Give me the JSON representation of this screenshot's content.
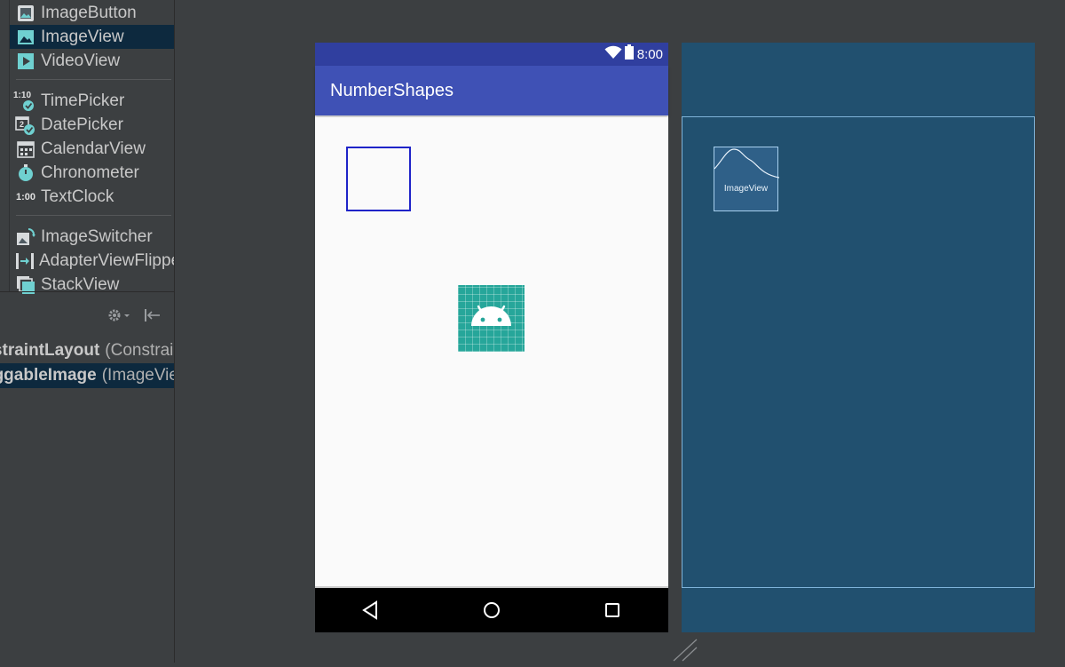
{
  "palette": {
    "items": [
      {
        "label": "ImageButton",
        "icon": "image-button-icon",
        "selected": false
      },
      {
        "label": "ImageView",
        "icon": "image-view-icon",
        "selected": true
      },
      {
        "label": "VideoView",
        "icon": "video-view-icon",
        "selected": false
      },
      {
        "label": "TimePicker",
        "icon": "time-picker-icon",
        "selected": false
      },
      {
        "label": "DatePicker",
        "icon": "date-picker-icon",
        "selected": false
      },
      {
        "label": "CalendarView",
        "icon": "calendar-view-icon",
        "selected": false
      },
      {
        "label": "Chronometer",
        "icon": "chronometer-icon",
        "selected": false
      },
      {
        "label": "TextClock",
        "icon": "text-clock-icon",
        "selected": false
      },
      {
        "label": "ImageSwitcher",
        "icon": "image-switcher-icon",
        "selected": false
      },
      {
        "label": "AdapterViewFlipper",
        "icon": "adapter-view-flipper-icon",
        "selected": false
      },
      {
        "label": "StackView",
        "icon": "stack-view-icon",
        "selected": false
      }
    ],
    "icon_text": {
      "time_picker": "1:10",
      "date_picker": "2",
      "text_clock": "1:00"
    }
  },
  "component_tree": {
    "rows": [
      {
        "name": "ConstraintLayout",
        "type": "(ConstraintLayout)"
      },
      {
        "name": "draggableImage",
        "type": "(ImageView)"
      }
    ]
  },
  "device": {
    "status_time": "8:00",
    "app_title": "NumberShapes"
  },
  "blueprint": {
    "imageview_label": "ImageView"
  },
  "colors": {
    "primary": "#3f51b5",
    "primary_dark": "#303f9f",
    "android_icon_bg": "#26a69a",
    "blueprint_bg": "#21506f",
    "selection_bg": "#0d293e"
  }
}
